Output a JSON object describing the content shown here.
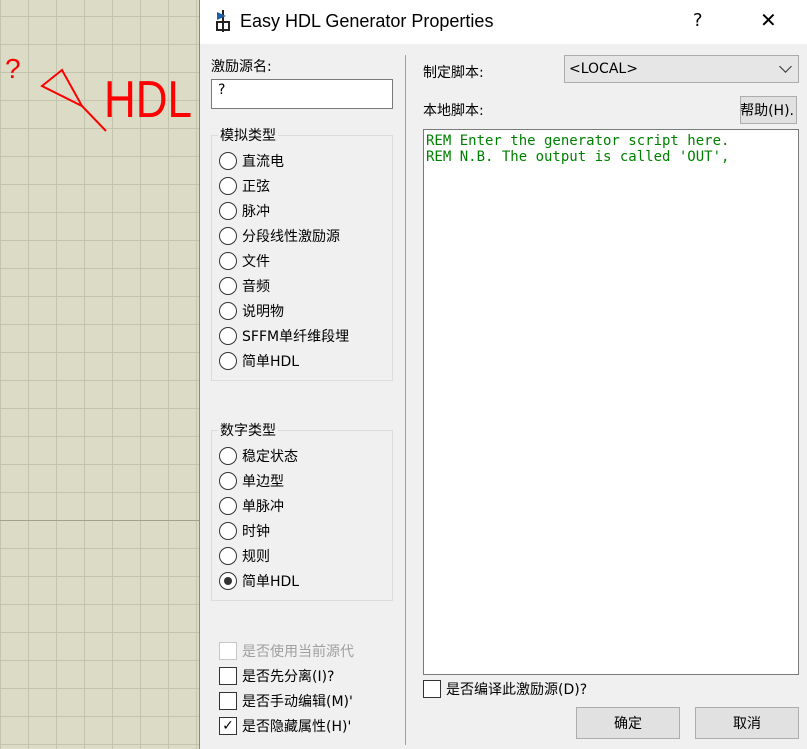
{
  "canvas": {
    "symbol_label": "?",
    "hdl_text": "HDL"
  },
  "dialog": {
    "title": "Easy HDL Generator Properties",
    "help_button": "?",
    "close_button": "✕"
  },
  "left": {
    "source_name_label": "激励源名:",
    "source_name_value": "?",
    "analog_group": {
      "title": "模拟类型",
      "options": [
        "直流电",
        "正弦",
        "脉冲",
        "分段线性激励源",
        "文件",
        "音频",
        "说明物",
        "SFFM单纤维段埋",
        "简单HDL"
      ],
      "selected": ""
    },
    "digital_group": {
      "title": "数字类型",
      "options": [
        "稳定状态",
        "单边型",
        "单脉冲",
        "时钟",
        "规则",
        "简单HDL"
      ],
      "selected": "简单HDL"
    },
    "checkboxes": [
      {
        "label": "是否使用当前源代",
        "checked": false,
        "disabled": true
      },
      {
        "label": "是否先分离(I)?",
        "checked": false,
        "disabled": false
      },
      {
        "label": "是否手动编辑(M)'",
        "checked": false,
        "disabled": false
      },
      {
        "label": "是否隐藏属性(H)'",
        "checked": true,
        "disabled": false
      }
    ]
  },
  "right": {
    "script_label": "制定脚本:",
    "script_select_value": "<LOCAL>",
    "local_script_label": "本地脚本:",
    "help_button": "帮助(H).",
    "script_lines": [
      "REM Enter the generator script here.",
      "REM N.B. The output is called 'OUT',"
    ],
    "compile_checkbox": {
      "label": "是否编译此激励源(D)?",
      "checked": false
    },
    "ok_button": "确定",
    "cancel_button": "取消"
  },
  "colors": {
    "canvas_bg": "#dcdcc6",
    "schematic_red": "#ff0000",
    "script_green": "#008000"
  }
}
